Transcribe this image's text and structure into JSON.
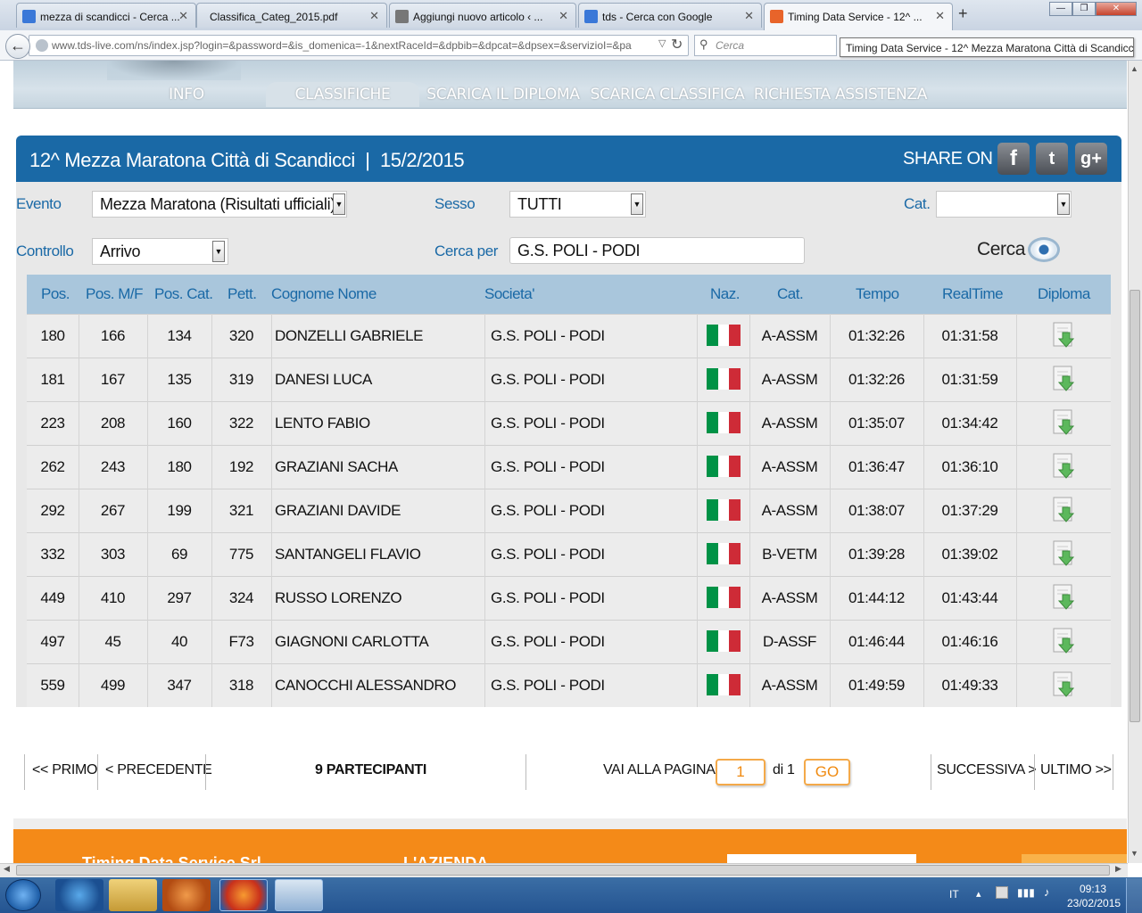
{
  "browser": {
    "tabs": [
      {
        "label": "mezza di scandicci - Cerca ...",
        "icon": "google-icon"
      },
      {
        "label": "Classifica_Categ_2015.pdf",
        "icon": "pdf-icon"
      },
      {
        "label": "Aggiungi nuovo articolo ‹ ...",
        "icon": "wordpress-icon"
      },
      {
        "label": "tds - Cerca con Google",
        "icon": "google-icon"
      },
      {
        "label": "Timing Data Service - 12^ ...",
        "icon": "tds-icon"
      }
    ],
    "new_tab": "+",
    "url": "www.tds-live.com/ns/index.jsp?login=&password=&is_domenica=-1&nextRaceId=&dpbib=&dpcat=&dpsex=&servizioI=&pa",
    "search_placeholder": "Cerca",
    "tooltip": "Timing Data Service - 12^ Mezza Maratona Città di Scandicci"
  },
  "site": {
    "menu": [
      "INFO",
      "CLASSIFICHE",
      "SCARICA IL DIPLOMA",
      "SCARICA CLASSIFICA",
      "RICHIESTA ASSISTENZA"
    ],
    "active_menu": "CLASSIFICHE",
    "title": "12^ Mezza Maratona Città di Scandicci  |  15/2/2015",
    "share_on": "SHARE ON",
    "social": [
      "f",
      "t",
      "g+"
    ]
  },
  "filters": {
    "evento_label": "Evento",
    "evento_value": "Mezza Maratona (Risultati ufficiali)",
    "sesso_label": "Sesso",
    "sesso_value": "TUTTI",
    "cat_label": "Cat.",
    "cat_value": "",
    "controllo_label": "Controllo",
    "controllo_value": "Arrivo",
    "cerca_per_label": "Cerca per",
    "cerca_per_value": "G.S. POLI - PODI",
    "cerca_button": "Cerca"
  },
  "table": {
    "headers": [
      "Pos.",
      "Pos. M/F",
      "Pos. Cat.",
      "Pett.",
      "Cognome Nome",
      "Societa'",
      "Naz.",
      "Cat.",
      "Tempo",
      "RealTime",
      "Diploma"
    ],
    "rows": [
      {
        "pos": "180",
        "pos_mf": "166",
        "pos_cat": "134",
        "pett": "320",
        "name": "DONZELLI GABRIELE",
        "societa": "G.S. POLI - PODI",
        "naz": "italy-flag",
        "cat": "A-ASSM",
        "tempo": "01:32:26",
        "realtime": "01:31:58"
      },
      {
        "pos": "181",
        "pos_mf": "167",
        "pos_cat": "135",
        "pett": "319",
        "name": "DANESI LUCA",
        "societa": "G.S. POLI - PODI",
        "naz": "italy-flag",
        "cat": "A-ASSM",
        "tempo": "01:32:26",
        "realtime": "01:31:59"
      },
      {
        "pos": "223",
        "pos_mf": "208",
        "pos_cat": "160",
        "pett": "322",
        "name": "LENTO FABIO",
        "societa": "G.S. POLI - PODI",
        "naz": "italy-flag",
        "cat": "A-ASSM",
        "tempo": "01:35:07",
        "realtime": "01:34:42"
      },
      {
        "pos": "262",
        "pos_mf": "243",
        "pos_cat": "180",
        "pett": "192",
        "name": "GRAZIANI SACHA",
        "societa": "G.S. POLI - PODI",
        "naz": "italy-flag",
        "cat": "A-ASSM",
        "tempo": "01:36:47",
        "realtime": "01:36:10"
      },
      {
        "pos": "292",
        "pos_mf": "267",
        "pos_cat": "199",
        "pett": "321",
        "name": "GRAZIANI DAVIDE",
        "societa": "G.S. POLI - PODI",
        "naz": "italy-flag",
        "cat": "A-ASSM",
        "tempo": "01:38:07",
        "realtime": "01:37:29"
      },
      {
        "pos": "332",
        "pos_mf": "303",
        "pos_cat": "69",
        "pett": "775",
        "name": "SANTANGELI FLAVIO",
        "societa": "G.S. POLI - PODI",
        "naz": "italy-flag",
        "cat": "B-VETM",
        "tempo": "01:39:28",
        "realtime": "01:39:02"
      },
      {
        "pos": "449",
        "pos_mf": "410",
        "pos_cat": "297",
        "pett": "324",
        "name": "RUSSO LORENZO",
        "societa": "G.S. POLI - PODI",
        "naz": "italy-flag",
        "cat": "A-ASSM",
        "tempo": "01:44:12",
        "realtime": "01:43:44"
      },
      {
        "pos": "497",
        "pos_mf": "45",
        "pos_cat": "40",
        "pett": "F73",
        "name": "GIAGNONI CARLOTTA",
        "societa": "G.S. POLI - PODI",
        "naz": "italy-flag",
        "cat": "D-ASSF",
        "tempo": "01:46:44",
        "realtime": "01:46:16"
      },
      {
        "pos": "559",
        "pos_mf": "499",
        "pos_cat": "347",
        "pett": "318",
        "name": "CANOCCHI ALESSANDRO",
        "societa": "G.S. POLI - PODI",
        "naz": "italy-flag",
        "cat": "A-ASSM",
        "tempo": "01:49:59",
        "realtime": "01:49:33"
      }
    ]
  },
  "pagination": {
    "primo": "<< PRIMO",
    "precedente": "< PRECEDENTE",
    "partecipanti": "9 PARTECIPANTI",
    "vai_alla_pagina": "VAI ALLA PAGINA",
    "page_value": "1",
    "di": "di 1",
    "go": "GO",
    "successiva": "SUCCESSIVA >",
    "ultimo": "ULTIMO >>"
  },
  "footer": {
    "company": "Timing Data Service Srl",
    "azienda": "L'AZIENDA"
  },
  "taskbar": {
    "language": "IT",
    "time": "09:13",
    "date": "23/02/2015"
  },
  "colors": {
    "brand_blue": "#1a69a6",
    "header_row": "#a9c6dc",
    "accent_orange": "#f48a18",
    "flag_green": "#009246",
    "flag_red": "#ce2b37"
  }
}
